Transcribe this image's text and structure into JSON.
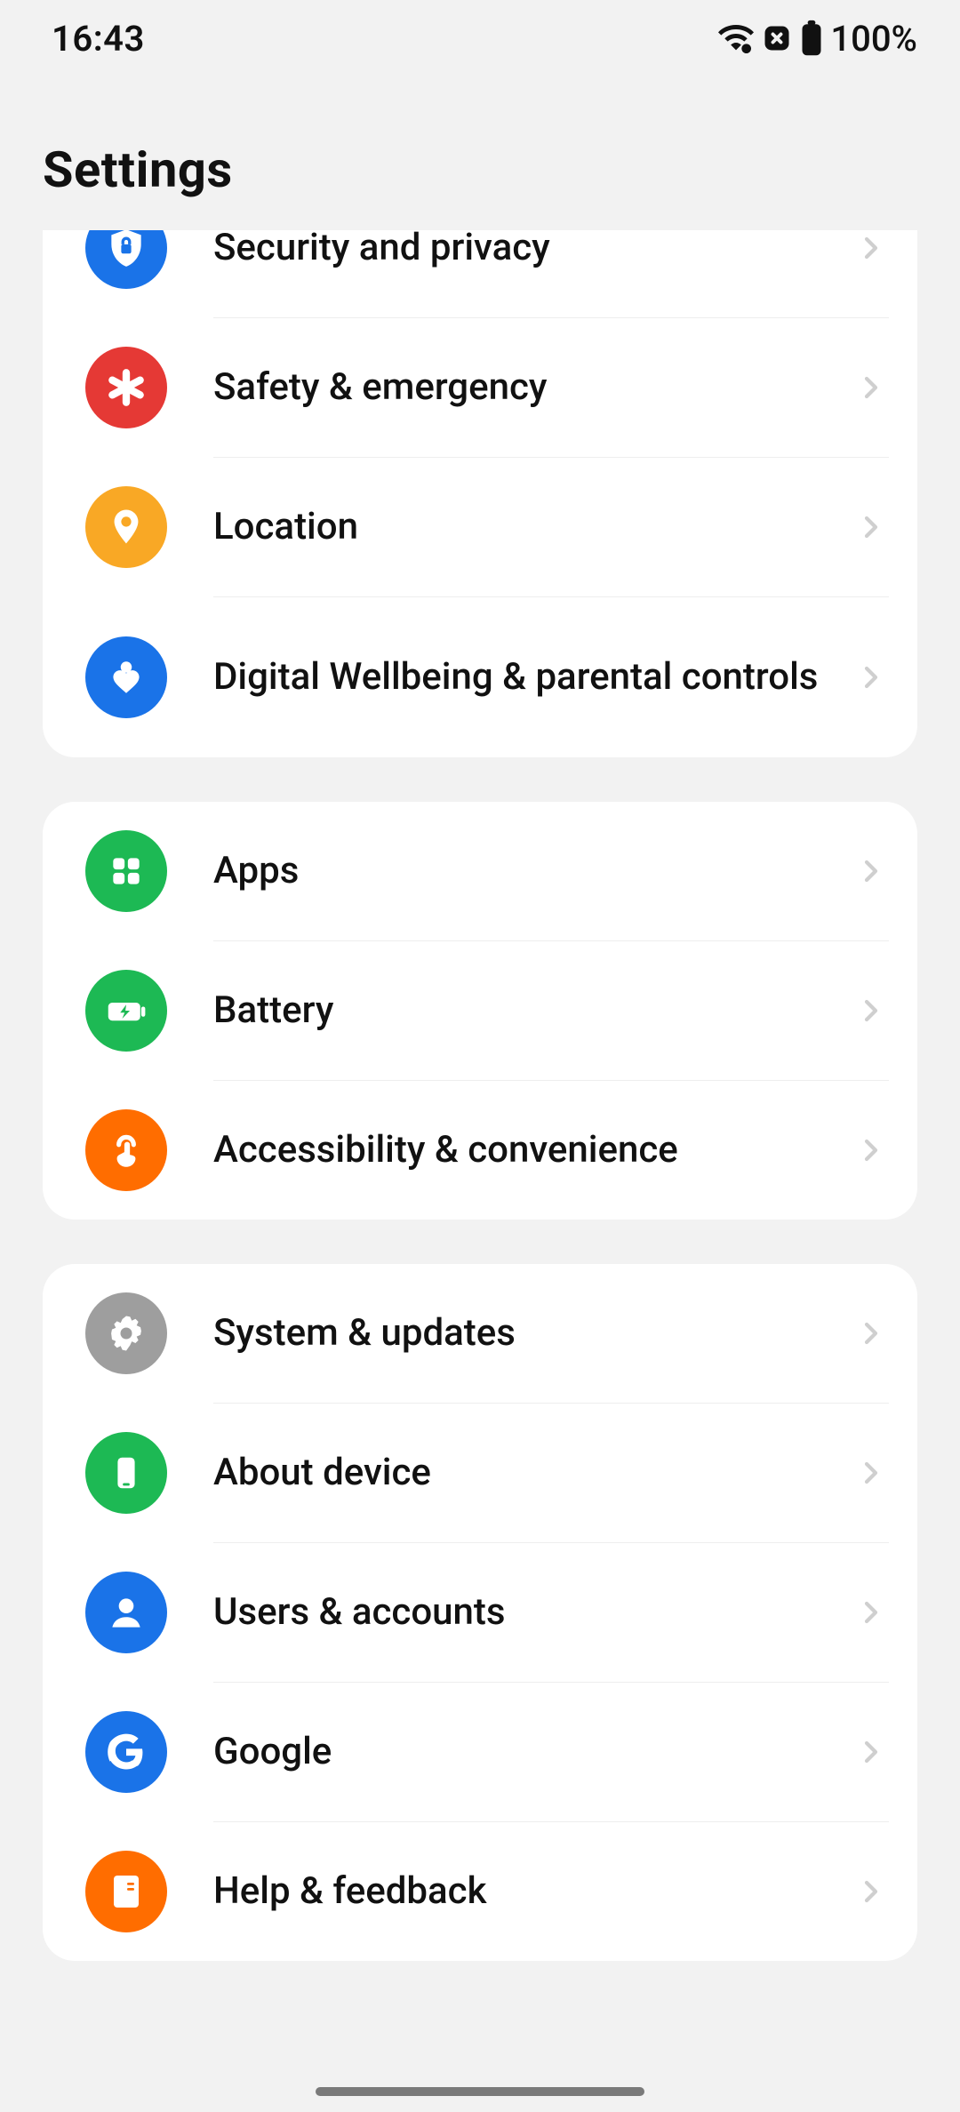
{
  "status": {
    "time": "16:43",
    "battery_pct": "100%"
  },
  "header": {
    "title": "Settings"
  },
  "groups": [
    {
      "rows": [
        {
          "id": "security",
          "label": "Security and privacy",
          "icon": "shield-lock",
          "color": "#1a73e8"
        },
        {
          "id": "safety",
          "label": "Safety & emergency",
          "icon": "asterisk",
          "color": "#e53935"
        },
        {
          "id": "location",
          "label": "Location",
          "icon": "pin",
          "color": "#f9a825"
        },
        {
          "id": "wellbeing",
          "label": "Digital Wellbeing & parental controls",
          "icon": "heart-person",
          "color": "#1a73e8"
        }
      ]
    },
    {
      "rows": [
        {
          "id": "apps",
          "label": "Apps",
          "icon": "grid4",
          "color": "#1db954"
        },
        {
          "id": "battery",
          "label": "Battery",
          "icon": "battery",
          "color": "#1db954"
        },
        {
          "id": "a11y",
          "label": "Accessibility & convenience",
          "icon": "touch",
          "color": "#ff6d00"
        }
      ]
    },
    {
      "rows": [
        {
          "id": "system",
          "label": "System & updates",
          "icon": "gear",
          "color": "#9e9e9e"
        },
        {
          "id": "about",
          "label": "About device",
          "icon": "phone",
          "color": "#1db954"
        },
        {
          "id": "users",
          "label": "Users & accounts",
          "icon": "person",
          "color": "#1a73e8"
        },
        {
          "id": "google",
          "label": "Google",
          "icon": "google",
          "color": "#1a73e8"
        },
        {
          "id": "help",
          "label": "Help & feedback",
          "icon": "book",
          "color": "#ff6d00"
        }
      ]
    }
  ]
}
